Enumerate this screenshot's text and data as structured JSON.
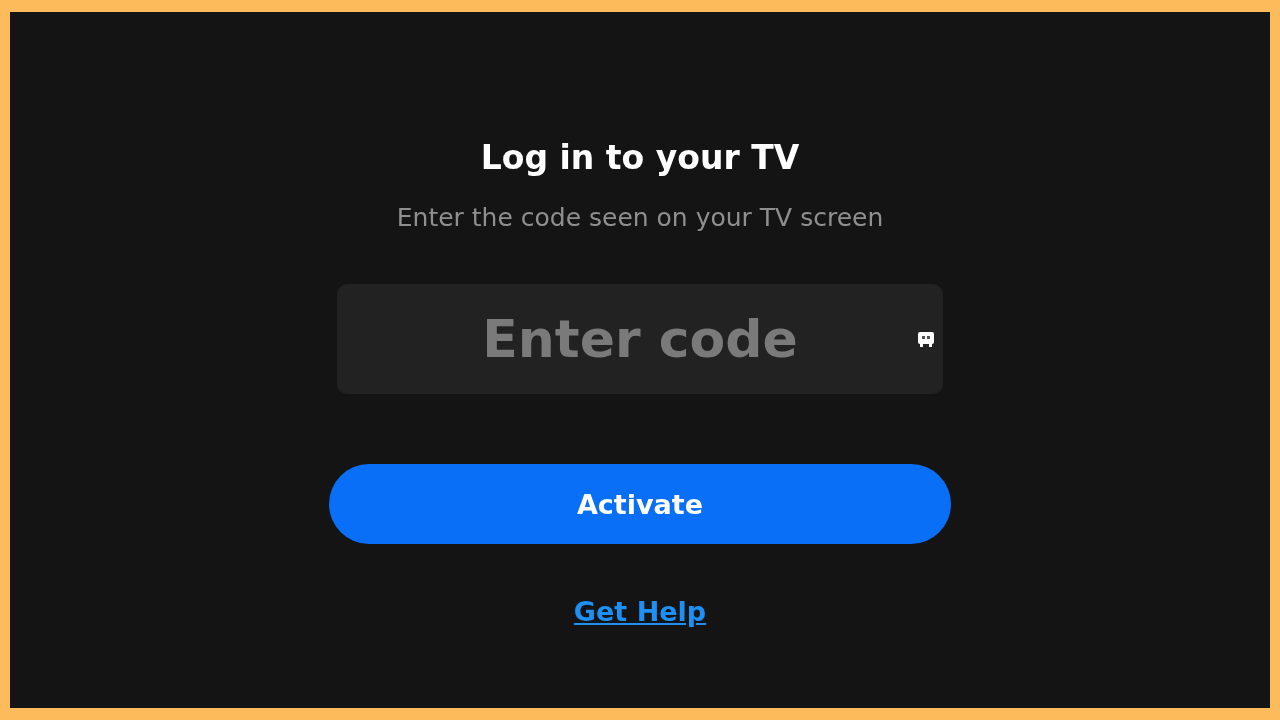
{
  "title": "Log in to your TV",
  "subtitle": "Enter the code seen on your TV screen",
  "code_field": {
    "placeholder": "Enter code"
  },
  "activate_button": "Activate",
  "help_link": "Get Help"
}
